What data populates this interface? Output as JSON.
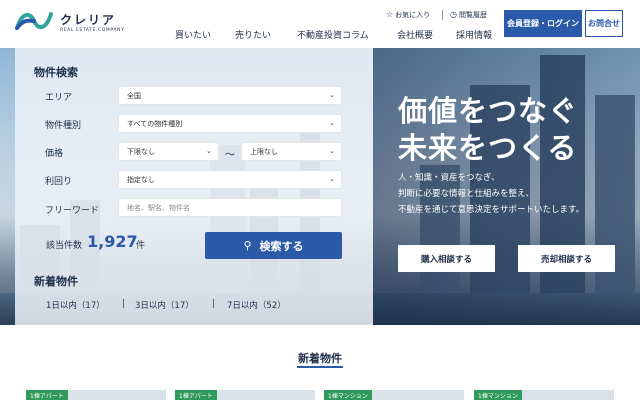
{
  "header": {
    "logo_name": "クレリア",
    "logo_sub": "REAL ESTATE COMPANY",
    "favorites_label": "お気に入り",
    "history_label": "閲覧履歴",
    "nav": [
      "買いたい",
      "売りたい",
      "不動産投資コラム",
      "会社概要",
      "採用情報"
    ],
    "register_label": "会員登録・ログイン",
    "contact_label": "お問合せ"
  },
  "search": {
    "title": "物件検索",
    "area_label": "エリア",
    "area_value": "全国",
    "type_label": "物件種別",
    "type_value": "すべての物件種別",
    "price_label": "価格",
    "price_min": "下限なし",
    "price_tilde": "〜",
    "price_max": "上限なし",
    "yield_label": "利回り",
    "yield_value": "指定なし",
    "keyword_label": "フリーワード",
    "keyword_placeholder": "地名、駅名、物件名",
    "count_label": "該当件数",
    "count_value": "1,927",
    "count_unit": "件",
    "search_button": "検索する"
  },
  "new_listings": {
    "title": "新着物件",
    "links": [
      "1日以内（17）",
      "3日以内（17）",
      "7日以内（52）"
    ]
  },
  "hero": {
    "catch_line1": "価値をつなぐ",
    "catch_line2": "未来をつくる",
    "sub_lines": [
      "人・知識・資産をつなぎ、",
      "判断に必要な情報と仕組みを整え、",
      "不動産を通じて意思決定をサポートいたします。"
    ],
    "buy_button": "購入相談する",
    "sell_button": "売却相談する"
  },
  "section": {
    "title": "新着物件",
    "card_tags": [
      "1棟アパート",
      "1棟アパート",
      "1棟マンション",
      "1棟マンション"
    ]
  },
  "colors": {
    "brand": "#2a5aa8",
    "text": "#1f2f4a",
    "tag": "#2f9a5a"
  }
}
